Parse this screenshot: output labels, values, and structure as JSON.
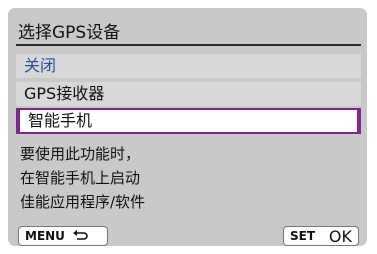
{
  "screen": {
    "title": "选择GPS设备",
    "options": [
      {
        "label": "关闭"
      },
      {
        "label": "GPS接收器"
      },
      {
        "label": "智能手机"
      }
    ],
    "description_lines": [
      "要使用此功能时，",
      "在智能手机上启动",
      "佳能应用程序/软件"
    ]
  },
  "footer": {
    "menu_label": "MENU",
    "set_label": "SET",
    "ok_label": "OK"
  },
  "colors": {
    "selection_border": "#7b2a8a",
    "inactive_text": "#2a4fa0",
    "panel_bg": "#c9c9c9"
  }
}
